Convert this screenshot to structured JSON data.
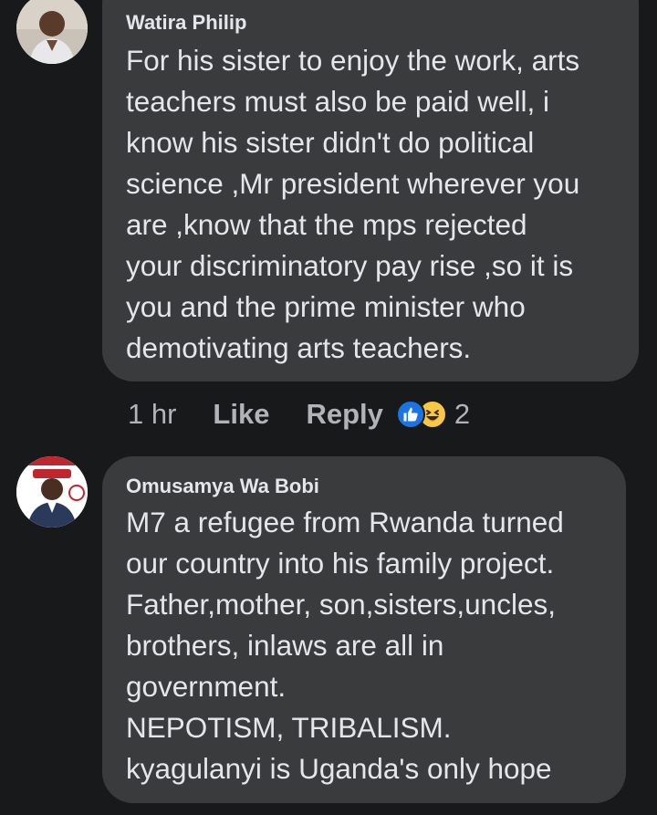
{
  "comments": [
    {
      "author": "Watira Philip",
      "text": "For his sister to enjoy the work, arts\nteachers must also be paid well, i\nknow his sister didn't do political\nscience ,Mr president wherever you\nare ,know that the mps rejected\nyour discriminatory pay rise ,so it is\nyou and the prime minister who\ndemotivating arts teachers.",
      "time": "1 hr",
      "like_label": "Like",
      "reply_label": "Reply",
      "reaction_count": "2",
      "reactions": [
        "like-icon",
        "haha-icon"
      ]
    },
    {
      "author": "Omusamya Wa Bobi",
      "text": "M7 a refugee from Rwanda turned\nour country into his family project.\nFather,mother, son,sisters,uncles,\nbrothers, inlaws are all in\ngovernment.\nNEPOTISM, TRIBALISM.\nkyagulanyi is Uganda's only hope"
    }
  ],
  "colors": {
    "background": "#18191a",
    "bubble": "#3a3b3c",
    "text": "#e4e6eb",
    "meta": "#b0b3b8",
    "like_blue": "#1b74e4",
    "haha_yellow": "#f7c843"
  }
}
